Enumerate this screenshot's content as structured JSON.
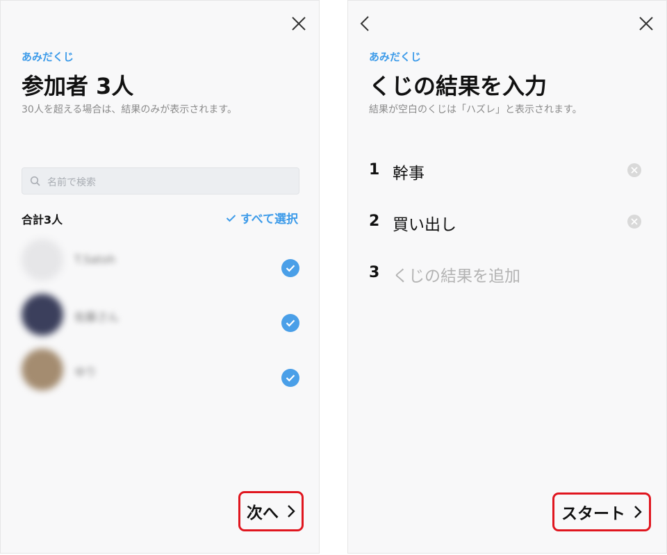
{
  "left": {
    "app_label": "あみだくじ",
    "title": "参加者 3人",
    "subtitle": "30人を超える場合は、結果のみが表示されます。",
    "search": {
      "placeholder": "名前で検索"
    },
    "total": "合計3人",
    "select_all": "すべて選択",
    "participants": [
      {
        "name": "T.Satoh",
        "avatar_color": "#e6e6e8",
        "checked": true
      },
      {
        "name": "佐藤さん",
        "avatar_color": "#3b3f5c",
        "checked": true
      },
      {
        "name": "ゆり",
        "avatar_color": "#a48c70",
        "checked": true
      }
    ],
    "next_label": "次へ"
  },
  "right": {
    "app_label": "あみだくじ",
    "title": "くじの結果を入力",
    "subtitle": "結果が空白のくじは「ハズレ」と表示されます。",
    "results": [
      {
        "num": "1",
        "text": "幹事"
      },
      {
        "num": "2",
        "text": "買い出し"
      },
      {
        "num": "3",
        "placeholder": "くじの結果を追加"
      }
    ],
    "start_label": "スタート"
  },
  "colors": {
    "accent": "#3d9be9",
    "highlight": "#e0161f",
    "check": "#4a9fe8"
  }
}
